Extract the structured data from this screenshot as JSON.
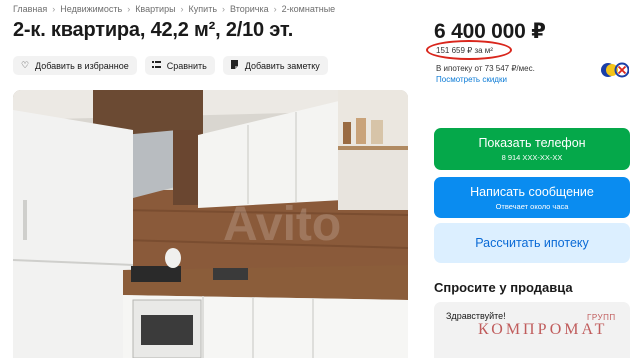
{
  "breadcrumb": [
    "Главная",
    "Недвижимость",
    "Квартиры",
    "Купить",
    "Вторичка",
    "2-комнатные"
  ],
  "listing": {
    "title": "2-к. квартира, 42,2 м², 2/10 эт.",
    "price": "6 400 000 ₽",
    "price_per_m2": "151 659 ₽ за м²",
    "mortgage_text": "В ипотеку от 73 547 ₽/мес.",
    "discount_link": "Посмотреть скидки"
  },
  "actions": {
    "favorite": "Добавить в избранное",
    "compare": "Сравнить",
    "note": "Добавить заметку"
  },
  "contact": {
    "phone_label": "Показать телефон",
    "phone_number": "8 914 XXX-XX-XX",
    "message_label": "Написать сообщение",
    "message_sub": "Отвечает около часа",
    "mortgage_button": "Рассчитать ипотеку"
  },
  "ask_seller": {
    "title": "Спросите у продавца",
    "text": "Здравствуйте!"
  },
  "watermark": {
    "main": "КОМПРОМАТ",
    "small": "ГРУПП"
  },
  "photo": {
    "watermark": "Avito"
  },
  "colors": {
    "primary_green": "#05a84a",
    "primary_blue": "#0a8cf0",
    "light_blue": "#dcefff",
    "link": "#0a7ad6",
    "highlight_ring": "#d9261c"
  }
}
